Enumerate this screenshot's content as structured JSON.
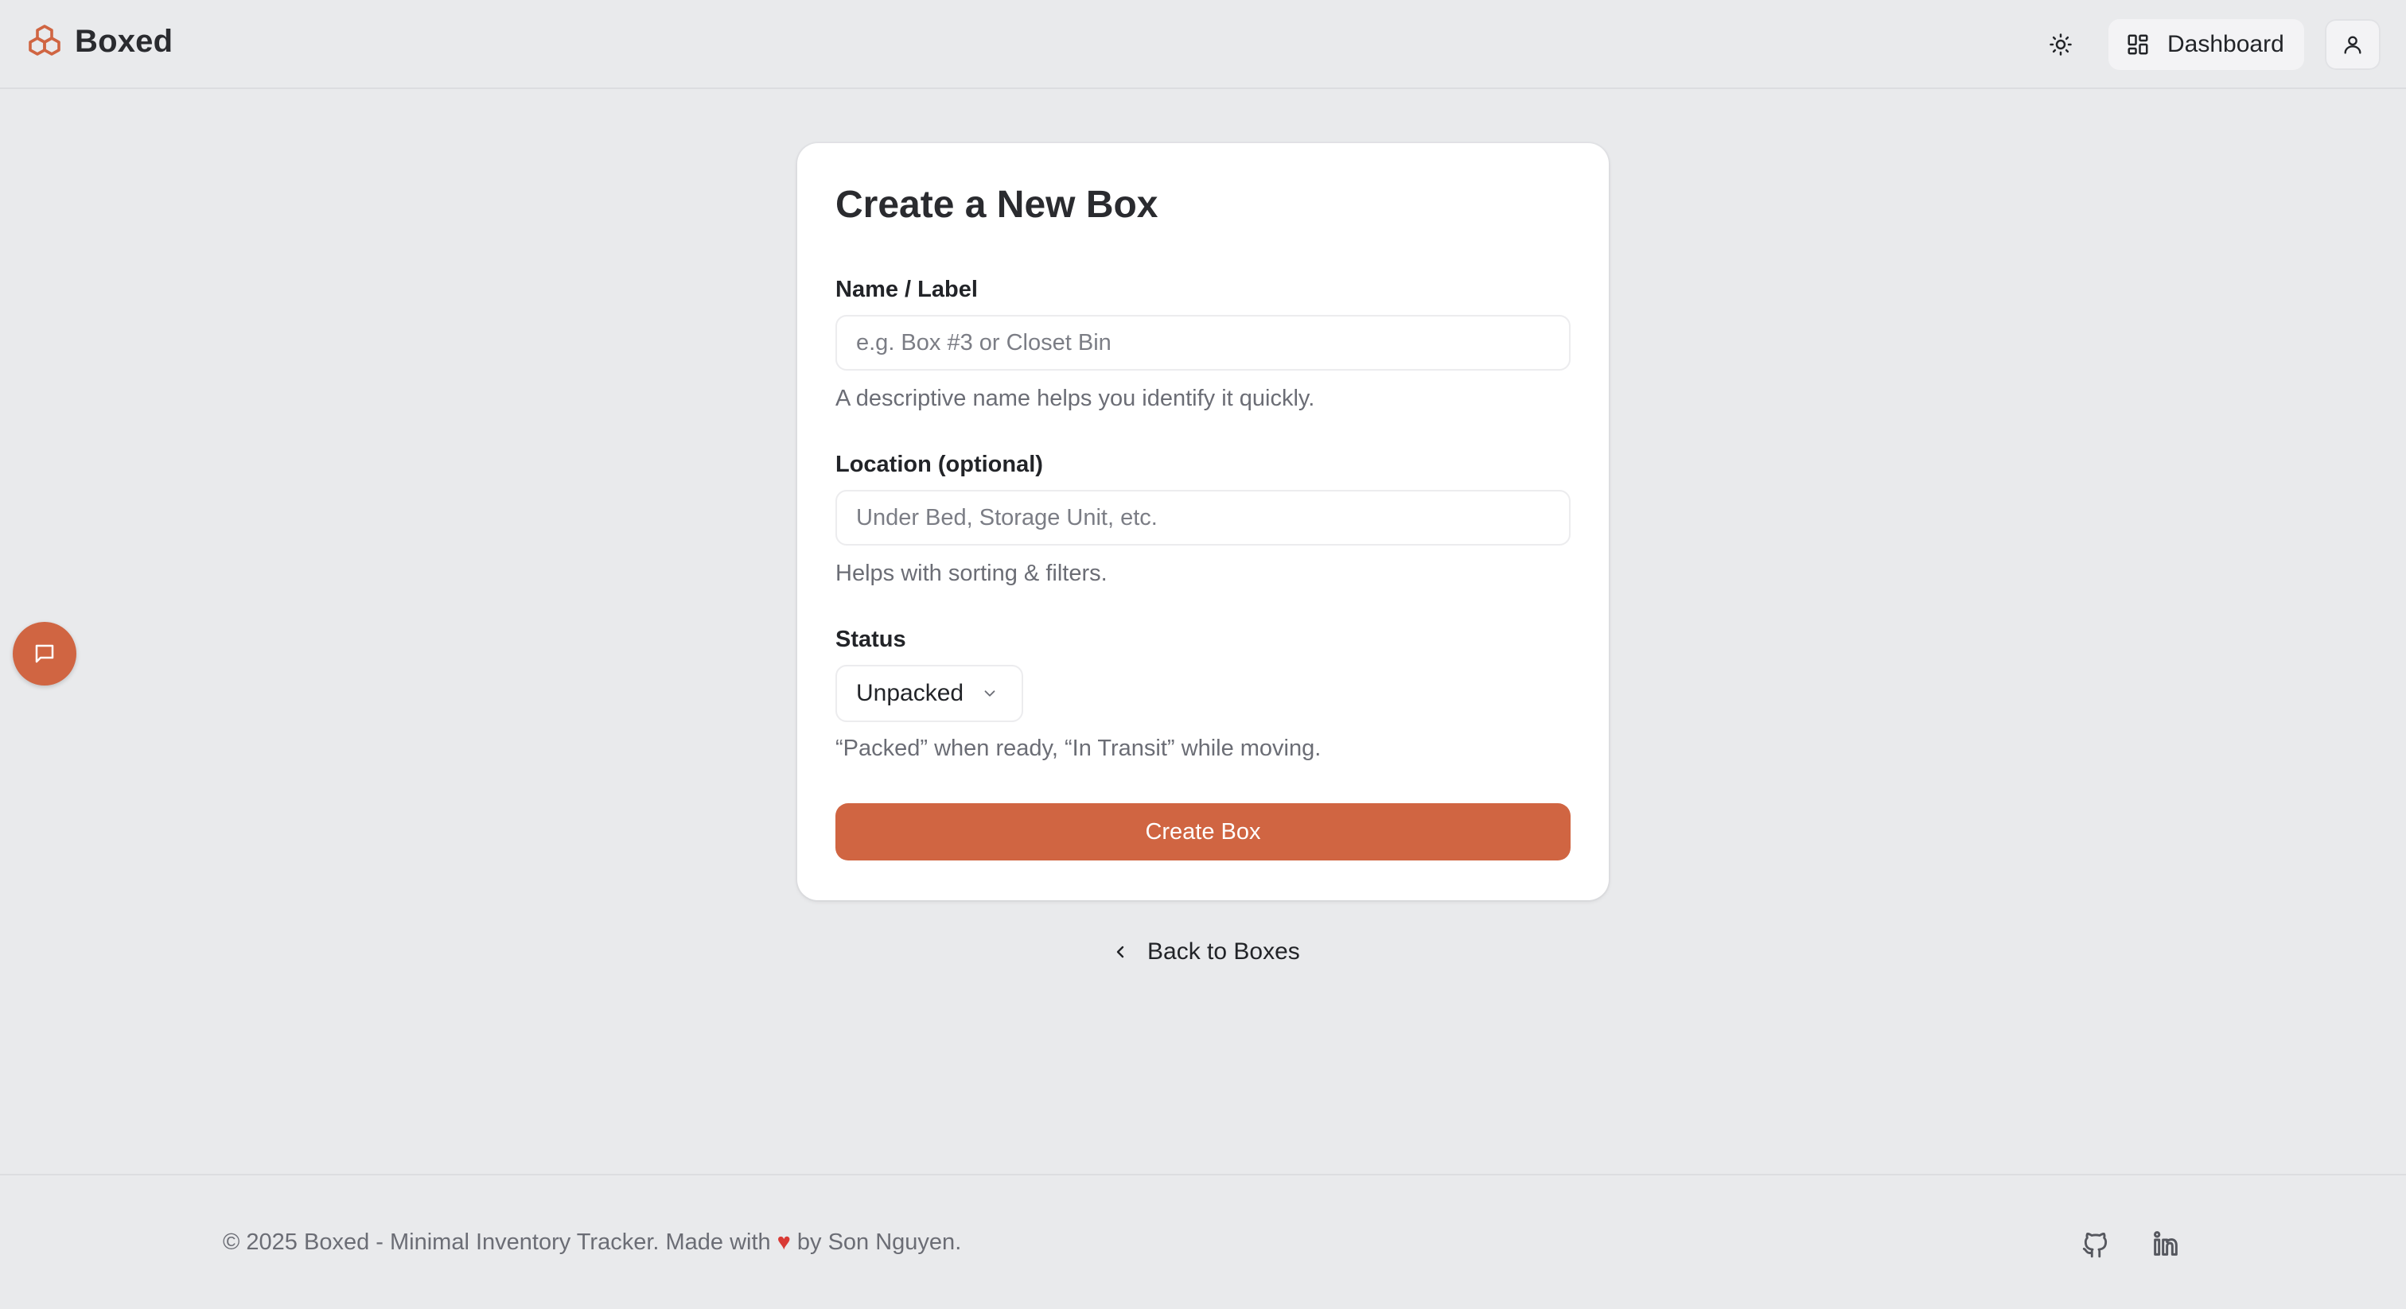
{
  "header": {
    "brand": "Boxed",
    "dashboard_label": "Dashboard"
  },
  "form": {
    "title": "Create a New Box",
    "name": {
      "label": "Name / Label",
      "placeholder": "e.g. Box #3 or Closet Bin",
      "help": "A descriptive name helps you identify it quickly."
    },
    "location": {
      "label": "Location (optional)",
      "placeholder": "Under Bed, Storage Unit, etc.",
      "help": "Helps with sorting & filters."
    },
    "status": {
      "label": "Status",
      "value": "Unpacked",
      "help": "“Packed” when ready, “In Transit” while moving."
    },
    "submit_label": "Create Box"
  },
  "back_link": "Back to Boxes",
  "footer": {
    "text_before": "© 2025 Boxed - Minimal Inventory Tracker. Made with",
    "heart": "♥",
    "text_after": "by Son Nguyen."
  },
  "colors": {
    "accent": "#d06542",
    "background": "#e9eaec",
    "card": "#ffffff",
    "heart": "#d93a35"
  },
  "icons": [
    "boxes-logo-icon",
    "sun-icon",
    "dashboard-grid-icon",
    "user-icon",
    "chat-icon",
    "chevron-down-icon",
    "chevron-left-icon",
    "github-icon",
    "linkedin-icon"
  ]
}
